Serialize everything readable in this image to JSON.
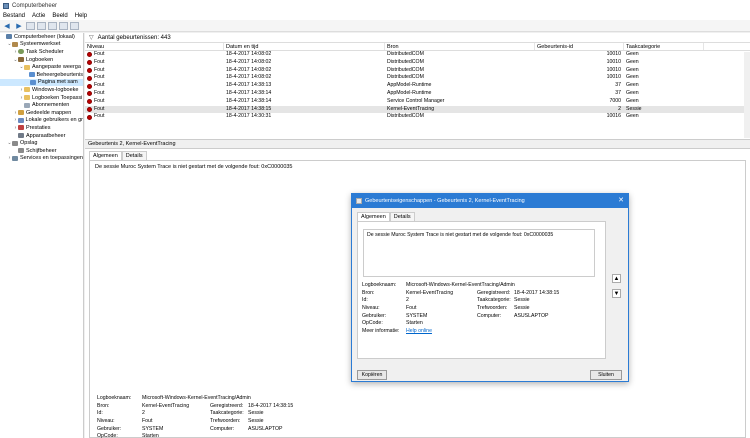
{
  "window": {
    "title": "Computerbeheer"
  },
  "menu": [
    "Bestand",
    "Actie",
    "Beeld",
    "Help"
  ],
  "tree": [
    {
      "label": "Computerbeheer (lokaal)",
      "indent": 0,
      "exp": "",
      "icon": "computer-icon",
      "cls": "ico-computer"
    },
    {
      "label": "Systeemwerkset",
      "indent": 1,
      "exp": "⌄",
      "icon": "tools-icon",
      "cls": "ico-tools"
    },
    {
      "label": "Task Scheduler",
      "indent": 2,
      "exp": "›",
      "icon": "clock-icon",
      "cls": "ico-clock"
    },
    {
      "label": "Logboeken",
      "indent": 2,
      "exp": "⌄",
      "icon": "book-icon",
      "cls": "ico-book"
    },
    {
      "label": "Aangepaste weerga",
      "indent": 3,
      "exp": "⌄",
      "icon": "folder-icon",
      "cls": "ico-folder"
    },
    {
      "label": "Beheergebeurtenis",
      "indent": 4,
      "exp": "",
      "icon": "filter-icon",
      "cls": "ico-filter"
    },
    {
      "label": "Pagina met sam",
      "indent": 4,
      "exp": "",
      "icon": "filter-icon",
      "cls": "ico-filter",
      "selected": true
    },
    {
      "label": "Windows-logboeke",
      "indent": 3,
      "exp": "›",
      "icon": "folder-icon",
      "cls": "ico-folder"
    },
    {
      "label": "Logboeken Toepassi",
      "indent": 3,
      "exp": "›",
      "icon": "folder-icon",
      "cls": "ico-folder"
    },
    {
      "label": "Abonnementen",
      "indent": 3,
      "exp": "",
      "icon": "log-icon",
      "cls": "ico-log"
    },
    {
      "label": "Gedeelde mappen",
      "indent": 2,
      "exp": "›",
      "icon": "share-icon",
      "cls": "ico-share"
    },
    {
      "label": "Lokale gebruikers en gr",
      "indent": 2,
      "exp": "›",
      "icon": "users-icon",
      "cls": "ico-users"
    },
    {
      "label": "Prestaties",
      "indent": 2,
      "exp": "›",
      "icon": "performance-icon",
      "cls": "ico-perf"
    },
    {
      "label": "Apparaatbeheer",
      "indent": 2,
      "exp": "",
      "icon": "device-icon",
      "cls": "ico-device"
    },
    {
      "label": "Opslag",
      "indent": 1,
      "exp": "⌄",
      "icon": "storage-icon",
      "cls": "ico-disk"
    },
    {
      "label": "Schijfbeheer",
      "indent": 2,
      "exp": "",
      "icon": "disk-icon",
      "cls": "ico-disk"
    },
    {
      "label": "Services en toepassingen",
      "indent": 1,
      "exp": "›",
      "icon": "services-icon",
      "cls": "ico-service"
    }
  ],
  "events": {
    "count_label": "Aantal gebeurtenissen: 443",
    "columns": [
      "Niveau",
      "Datum en tijd",
      "Bron",
      "Gebeurtenis-id",
      "Taakcategorie"
    ],
    "rows": [
      [
        "Fout",
        "18-4-2017 14:08:02",
        "DistributedCOM",
        "10010",
        "Geen"
      ],
      [
        "Fout",
        "18-4-2017 14:08:02",
        "DistributedCOM",
        "10010",
        "Geen"
      ],
      [
        "Fout",
        "18-4-2017 14:08:02",
        "DistributedCOM",
        "10010",
        "Geen"
      ],
      [
        "Fout",
        "18-4-2017 14:08:02",
        "DistributedCOM",
        "10010",
        "Geen"
      ],
      [
        "Fout",
        "18-4-2017 14:38:13",
        "AppModel-Runtime",
        "37",
        "Geen"
      ],
      [
        "Fout",
        "18-4-2017 14:38:14",
        "AppModel-Runtime",
        "37",
        "Geen"
      ],
      [
        "Fout",
        "18-4-2017 14:38:14",
        "Service Control Manager",
        "7000",
        "Geen"
      ],
      [
        "Fout",
        "18-4-2017 14:38:15",
        "Kernel-EventTracing",
        "2",
        "Sessie"
      ],
      [
        "Fout",
        "18-4-2017 14:30:31",
        "DistributedCOM",
        "10016",
        "Geen"
      ]
    ],
    "highlight_index": 7
  },
  "detail": {
    "title": "Gebeurtenis 2, Kernel-EventTracing",
    "tabs": [
      "Algemeen",
      "Details"
    ],
    "description": "De sessie Muroc System Trace is niet gestart met de volgende fout: 0xC0000035",
    "labels": {
      "logname": "Logboeknaam:",
      "source": "Bron:",
      "id": "Id:",
      "level": "Niveau:",
      "user": "Gebruiker:",
      "opcode": "OpCode:",
      "more": "Meer informatie:",
      "logged": "Geregistreerd:",
      "category": "Taakcategorie:",
      "keywords": "Trefwoorden:",
      "computer": "Computer:"
    },
    "values": {
      "logname": "Microsoft-Windows-Kernel-EventTracing/Admin",
      "source": "Kernel-EventTracing",
      "id": "2",
      "level": "Fout",
      "user": "SYSTEM",
      "opcode": "Starten",
      "more": "Help online",
      "logged": "18-4-2017 14:38:15",
      "category": "Sessie",
      "keywords": "Sessie",
      "computer": "ASUSLAPTOP"
    }
  },
  "dialog": {
    "title": "Gebeurteniseigenschappen - Gebeurtenis 2, Kernel-EventTracing",
    "tabs": [
      "Algemeen",
      "Details"
    ],
    "copy_label": "Kopiëren",
    "close_label": "Sluiten"
  }
}
